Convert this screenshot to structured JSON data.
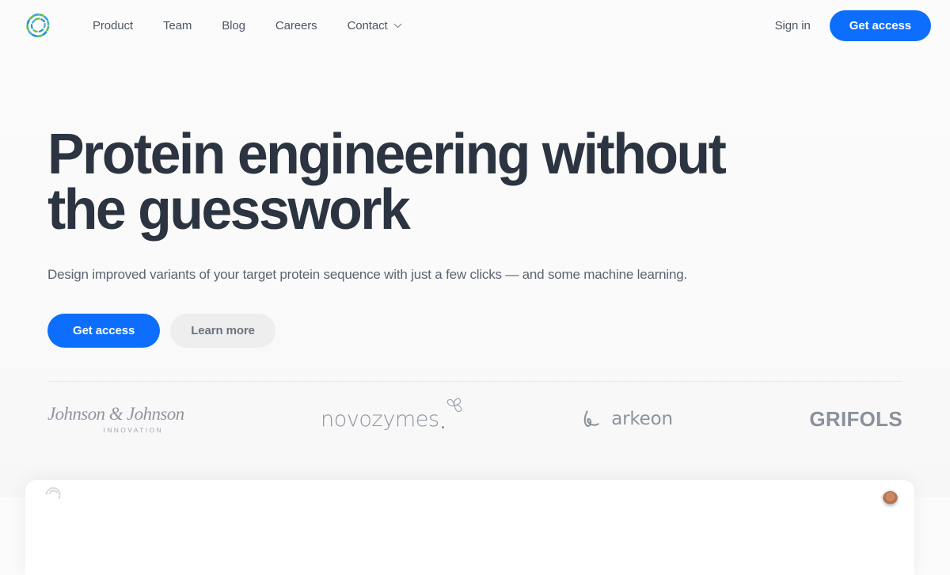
{
  "header": {
    "logo_icon": "cradle-circular-dash-logo",
    "nav": [
      {
        "label": "Product",
        "icon": null
      },
      {
        "label": "Team",
        "icon": null
      },
      {
        "label": "Blog",
        "icon": null
      },
      {
        "label": "Careers",
        "icon": null
      },
      {
        "label": "Contact",
        "icon": "chevron-down-icon"
      }
    ],
    "sign_in_label": "Sign in",
    "get_access_label": "Get access"
  },
  "hero": {
    "headline": "Protein engineering without the guesswork",
    "subhead": "Design improved variants of your target protein sequence with just a few clicks — and some machine learning.",
    "primary_cta": "Get access",
    "secondary_cta": "Learn more"
  },
  "logos": {
    "jnj": {
      "name": "Johnson & Johnson",
      "sub": "INNOVATION"
    },
    "novozymes": {
      "name": "novozymes",
      "mark": "trefoil-mark"
    },
    "arkeon": {
      "name": "arkeon",
      "mark": "cursive-e-mark"
    },
    "grifols": {
      "name": "GRIFOLS"
    }
  },
  "app_card": {
    "logo_icon": "cradle-circular-dash-logo-grey",
    "avatar_icon": "user-avatar"
  },
  "colors": {
    "accent_blue": "#0d6efd",
    "heading": "#2b3440",
    "body_text": "#5c6471",
    "muted_logo": "#8b919b",
    "background": "#fafafa",
    "secondary_button": "#eeeeef"
  }
}
